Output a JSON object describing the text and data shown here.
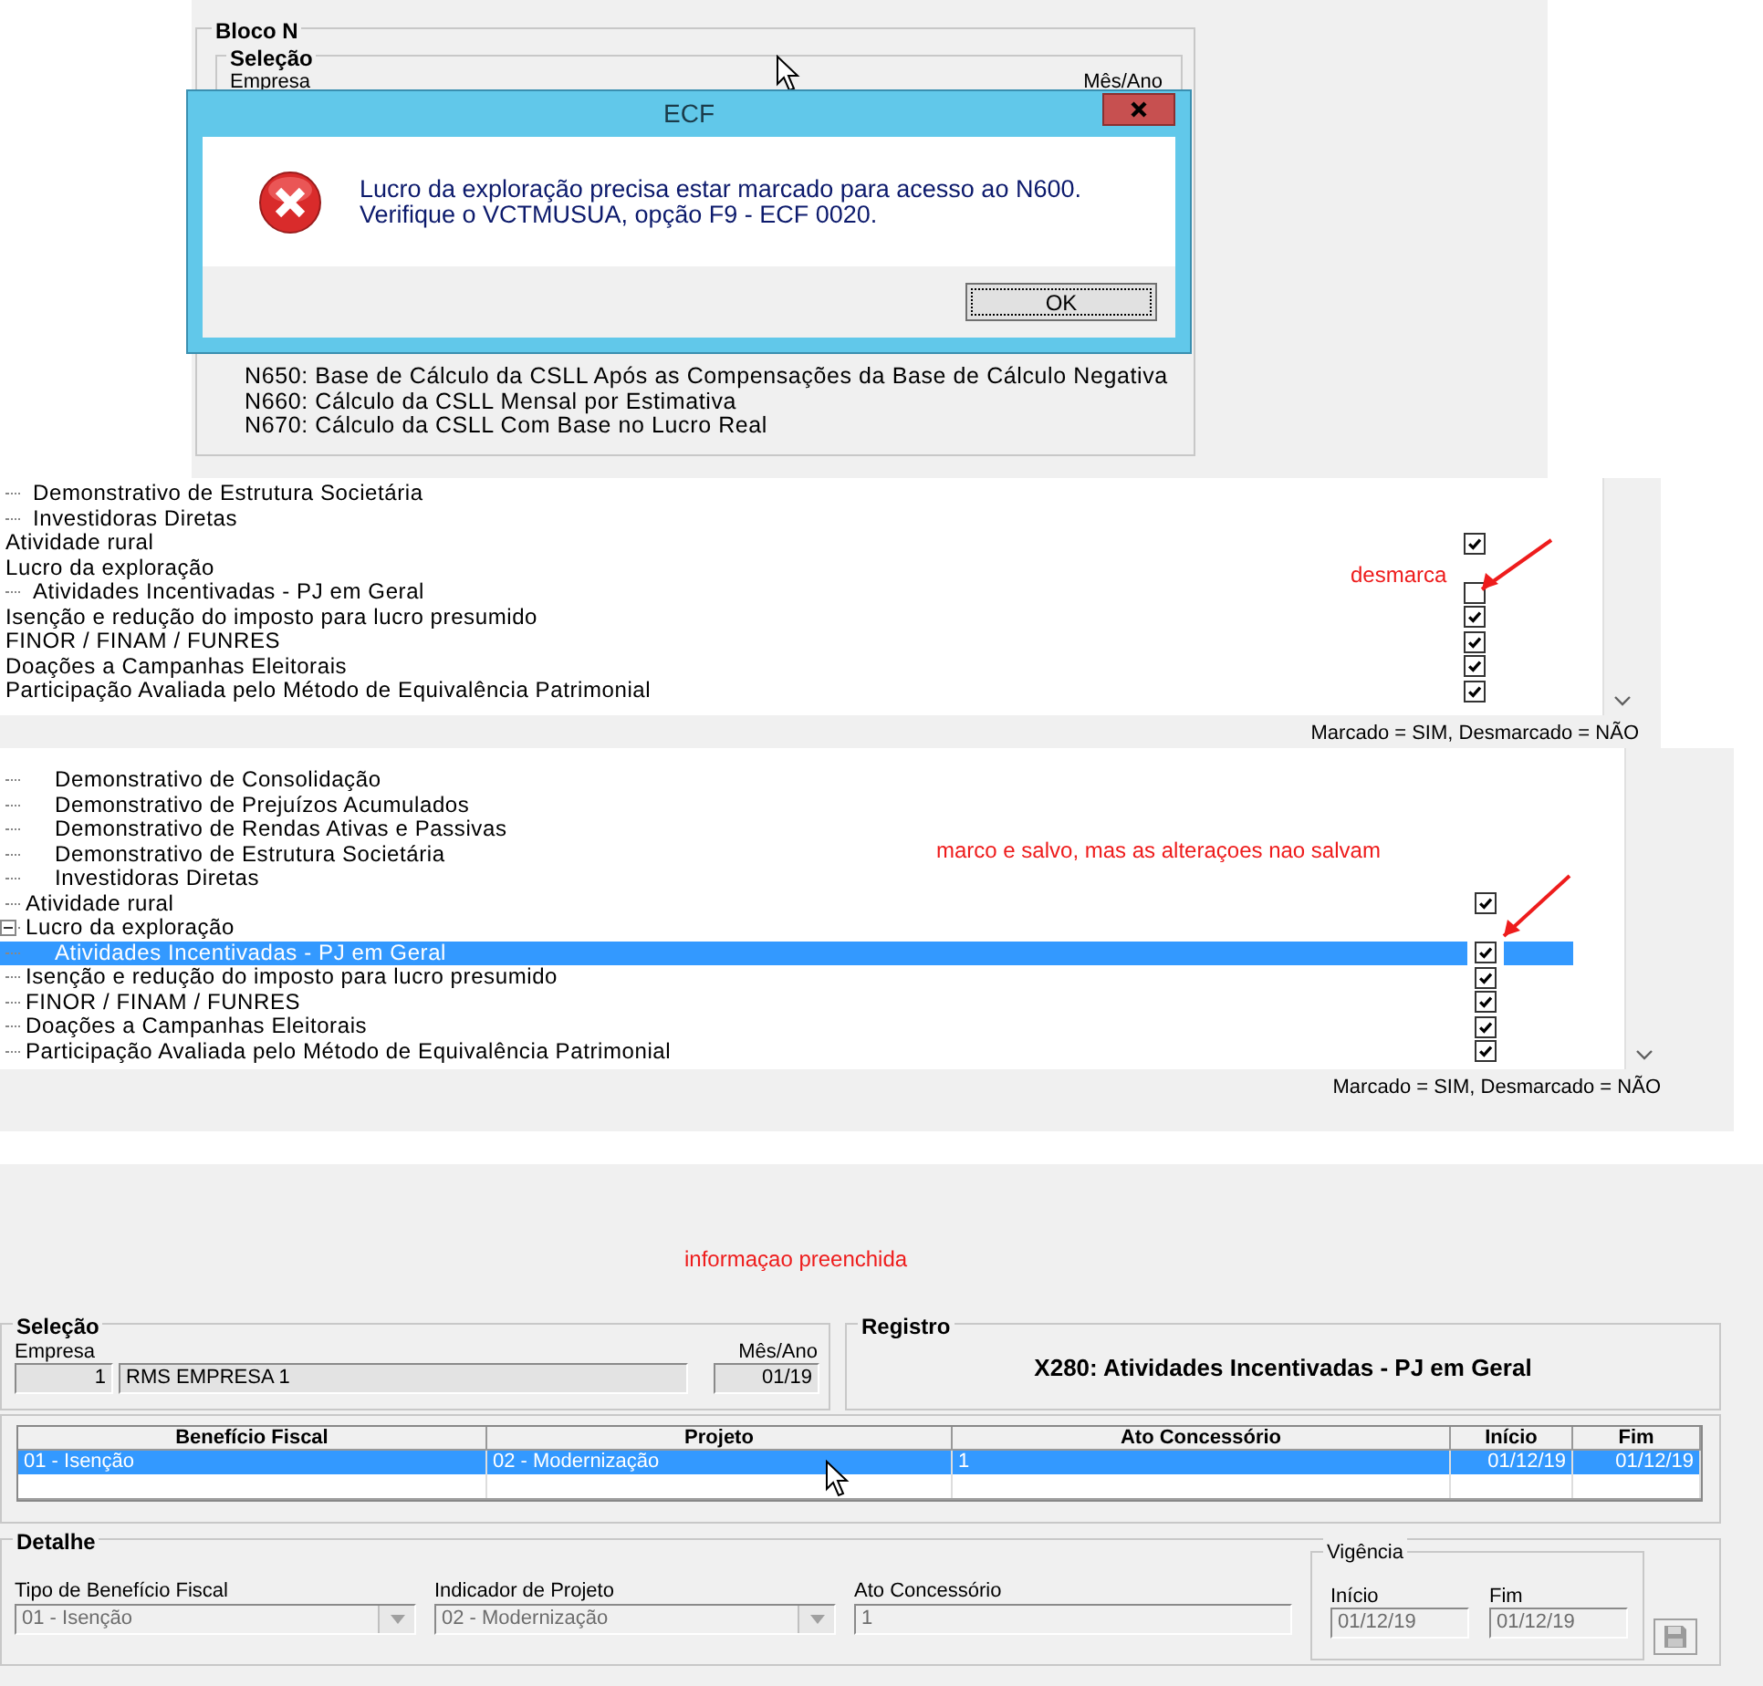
{
  "error_screen": {
    "group_title": "Bloco N",
    "selection_title": "Seleção",
    "empresa_label": "Empresa",
    "mes_ano_label": "Mês/Ano",
    "registers": [
      "N650: Base de Cálculo da CSLL Após as Compensações da Base de Cálculo Negativa",
      "N660: Cálculo da CSLL Mensal por Estimativa",
      "N670: Cálculo da CSLL Com Base no Lucro Real"
    ],
    "dialog": {
      "title": "ECF",
      "message_lines": [
        "Lucro da exploração precisa estar marcado para acesso ao N600.",
        "Verifique o VCTMUSUA, opção F9 - ECF 0020."
      ],
      "ok_button": "OK"
    }
  },
  "tree_before": {
    "items": [
      {
        "children": [
          {
            "label": "Demonstrativo de Estrutura Societária"
          },
          {
            "label": "Investidoras Diretas"
          }
        ]
      },
      {
        "label": "Atividade rural",
        "checked": true
      },
      {
        "label": "Lucro da exploração",
        "children": [
          {
            "label": "Atividades Incentivadas - PJ em Geral",
            "checked": false
          }
        ]
      },
      {
        "label": "Isenção e redução do imposto para lucro presumido",
        "checked": true
      },
      {
        "label": "FINOR / FINAM / FUNRES",
        "checked": true
      },
      {
        "label": "Doações a Campanhas Eleitorais",
        "checked": true
      },
      {
        "label": "Participação Avaliada pelo Método de Equivalência Patrimonial",
        "checked": true
      }
    ],
    "note": "desmarca",
    "legend": "Marcado = SIM, Desmarcado = NÃO"
  },
  "tree_after": {
    "items": [
      {
        "children": [
          {
            "label": "Demonstrativo de Consolidação",
            "selected": false
          },
          {
            "label": "Demonstrativo de Prejuízos Acumulados",
            "selected": false
          },
          {
            "label": "Demonstrativo de Rendas Ativas e Passivas",
            "selected": false
          },
          {
            "label": "Demonstrativo de Estrutura Societária",
            "selected": false
          },
          {
            "label": "Investidoras Diretas",
            "selected": false
          }
        ]
      },
      {
        "label": "Atividade rural",
        "checked": true,
        "selected": false
      },
      {
        "label": "Lucro da exploração",
        "expanded": true,
        "selected": false,
        "children": [
          {
            "label": "Atividades Incentivadas - PJ em Geral",
            "checked": true,
            "selected": true
          }
        ]
      },
      {
        "label": "Isenção e redução do imposto para lucro presumido",
        "checked": true,
        "selected": false
      },
      {
        "label": "FINOR / FINAM / FUNRES",
        "checked": true,
        "selected": false
      },
      {
        "label": "Doações a Campanhas Eleitorais",
        "checked": true,
        "selected": false
      },
      {
        "label": "Participação Avaliada pelo Método de Equivalência Patrimonial",
        "checked": true,
        "selected": false
      }
    ],
    "note": "marco e salvo, mas as alteraçoes nao salvam",
    "legend": "Marcado = SIM, Desmarcado = NÃO"
  },
  "form_screen": {
    "note": "informaçao preenchida",
    "selection": {
      "title": "Seleção",
      "empresa_label": "Empresa",
      "empresa_code": "1",
      "empresa_name": "RMS EMPRESA 1",
      "mes_ano_label": "Mês/Ano",
      "mes_ano": "01/19"
    },
    "registro": {
      "title": "Registro",
      "text": "X280: Atividades Incentivadas - PJ em Geral"
    },
    "table": {
      "columns": [
        "Benefício Fiscal",
        "Projeto",
        "Ato Concessório",
        "Início",
        "Fim"
      ],
      "rows": [
        {
          "cells": [
            "01 - Isenção",
            "02 - Modernização",
            "1",
            "01/12/19",
            "01/12/19"
          ],
          "selected": true
        }
      ]
    },
    "detail": {
      "title": "Detalhe",
      "fields": [
        {
          "kind": "combo",
          "label": "Tipo de Benefício Fiscal",
          "value": "01 - Isenção",
          "disabled": true
        },
        {
          "kind": "combo",
          "label": "Indicador de Projeto",
          "value": "02 - Modernização",
          "disabled": true
        },
        {
          "kind": "text",
          "label": "Ato Concessório",
          "value": "1",
          "disabled": true
        }
      ],
      "vigencia": {
        "title": "Vigência",
        "fields": [
          {
            "label": "Início",
            "value": "01/12/19",
            "disabled": true
          },
          {
            "label": "Fim",
            "value": "01/12/19",
            "disabled": true
          }
        ]
      },
      "save_disabled": true
    }
  }
}
